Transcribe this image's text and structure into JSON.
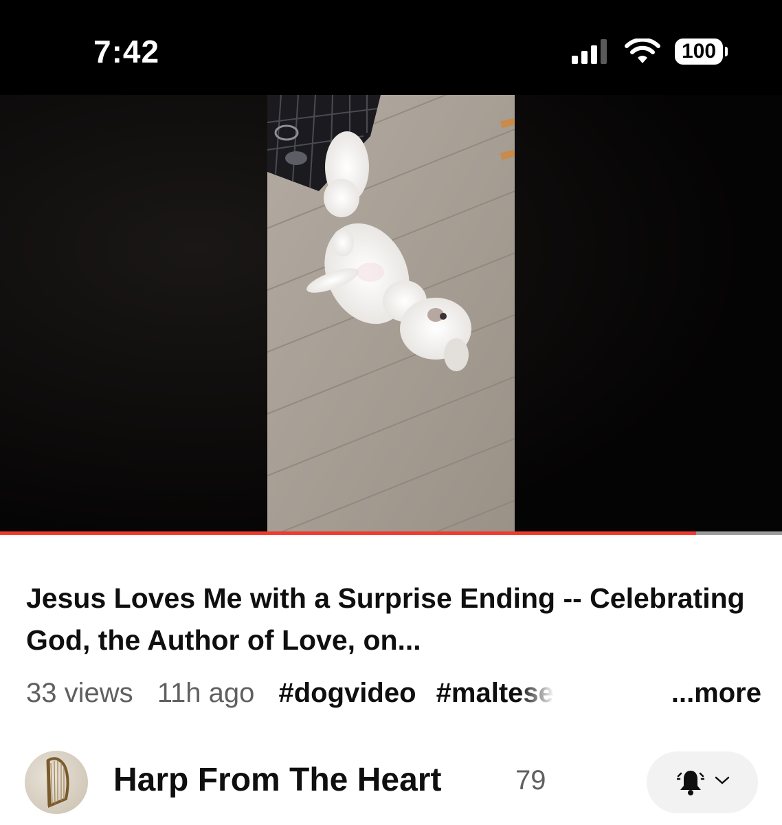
{
  "status_bar": {
    "time": "7:42",
    "battery": "100",
    "icons": [
      "signal-icon",
      "wifi-icon",
      "battery-icon"
    ]
  },
  "video": {
    "progress_fraction": 0.89,
    "progress_color": "#f03a2e"
  },
  "metadata": {
    "title": "Jesus Loves Me with a Surprise Ending  -- Celebrating God, the Author of Love, on...",
    "views": "33 views",
    "age": "11h ago",
    "hashtags": [
      "#dogvideo",
      "#maltese"
    ],
    "more_label": "...more"
  },
  "channel": {
    "name": "Harp From The Heart",
    "subscribers": "79",
    "icons": [
      "harp-avatar",
      "bell-icon",
      "chevron-down-icon"
    ]
  }
}
